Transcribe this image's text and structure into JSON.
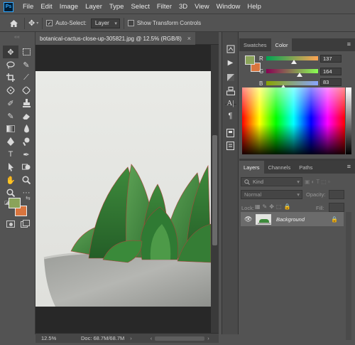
{
  "app": {
    "logo_text": "Ps"
  },
  "menu": [
    "File",
    "Edit",
    "Image",
    "Layer",
    "Type",
    "Select",
    "Filter",
    "3D",
    "View",
    "Window",
    "Help"
  ],
  "options_bar": {
    "auto_select_label": "Auto-Select:",
    "auto_select_checked": true,
    "auto_select_target": "Layer",
    "show_transform_label": "Show Transform Controls",
    "show_transform_checked": false
  },
  "document": {
    "tab_title": "botanical-cactus-close-up-305821.jpg @ 12.5% (RGB/8)",
    "close_glyph": "×",
    "zoom": "12.5%",
    "doc_size": "Doc: 68.7M/68.7M"
  },
  "colors": {
    "foreground": "#8aa35a",
    "background": "#d9753e",
    "swatch_fg_panel": "#8aa35a",
    "swatch_bg_panel": "#d9753e"
  },
  "color_panel": {
    "tabs": [
      "Swatches",
      "Color"
    ],
    "selected_tab": "Color",
    "r_label": "R",
    "r_value": "137",
    "g_label": "G",
    "g_value": "164",
    "b_label": "B",
    "b_value": "83",
    "r_level": 0.537,
    "g_level": 0.643,
    "b_level": 0.325
  },
  "layers_panel": {
    "tabs": [
      "Layers",
      "Channels",
      "Paths"
    ],
    "selected_tab": "Layers",
    "kind_label": "Kind",
    "blend_mode": "Normal",
    "opacity_label": "Opacity:",
    "lock_label": "Lock:",
    "fill_label": "Fill:",
    "layers": [
      {
        "name": "Background",
        "visible": true,
        "locked": true
      }
    ]
  }
}
